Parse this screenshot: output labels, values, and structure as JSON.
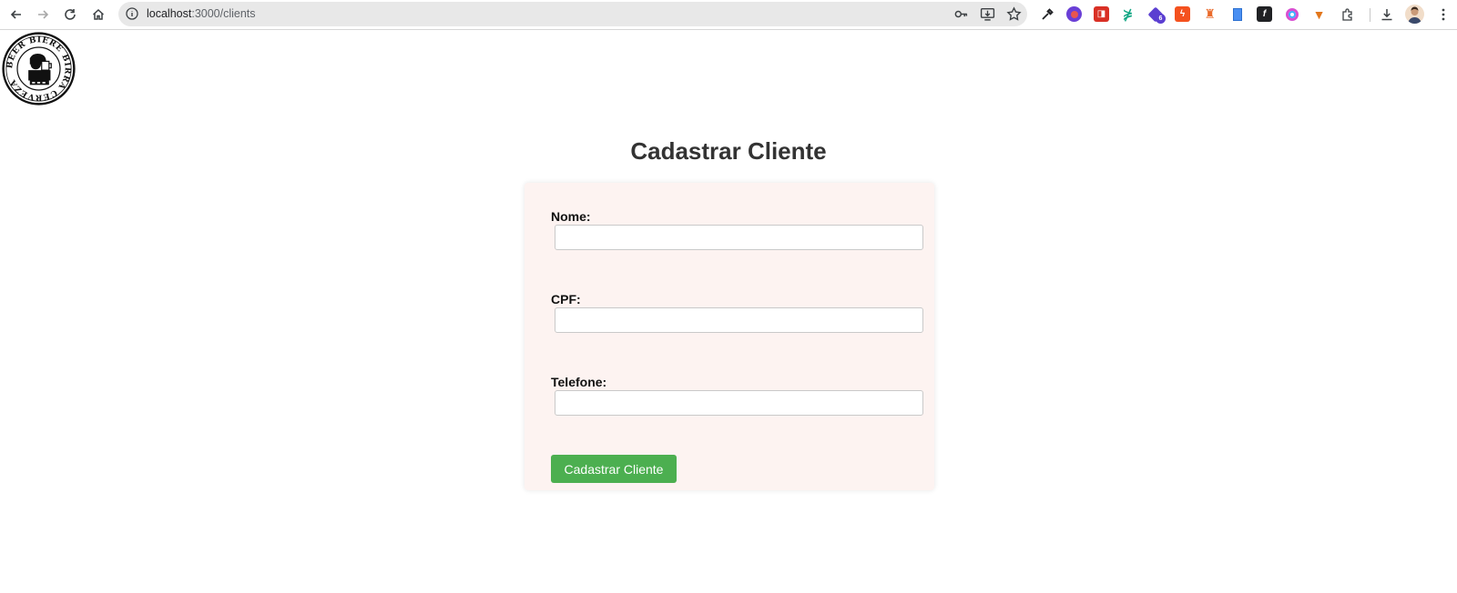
{
  "browser": {
    "url_host": "localhost",
    "url_rest": ":3000/clients",
    "extension_badge": "6"
  },
  "form": {
    "title": "Cadastrar Cliente",
    "fields": [
      {
        "label": "Nome:",
        "value": ""
      },
      {
        "label": "CPF:",
        "value": ""
      },
      {
        "label": "Telefone:",
        "value": ""
      }
    ],
    "submit_label": "Cadastrar Cliente"
  },
  "logo": {
    "text": "BEER BIERE BIRRA CERVEZA"
  },
  "colors": {
    "accent_button": "#4caf50",
    "card_background": "#fdf3f1",
    "title_text": "#333333"
  }
}
